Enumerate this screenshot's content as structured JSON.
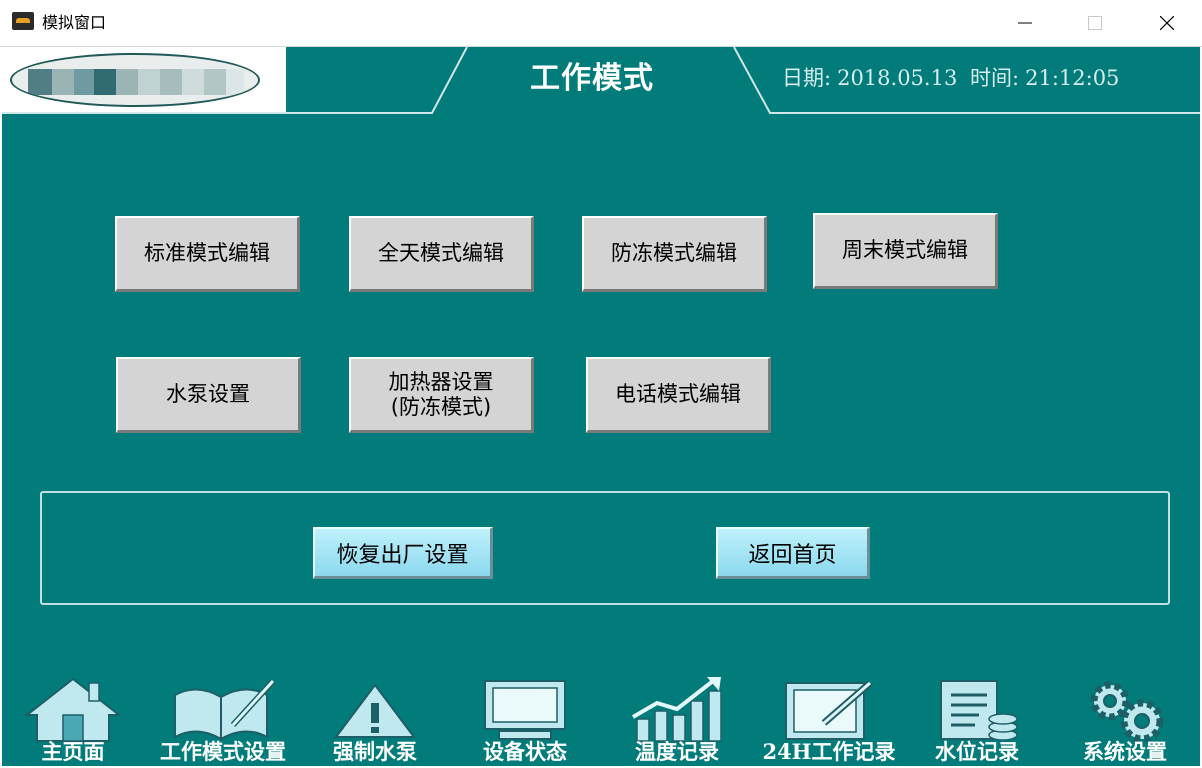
{
  "window": {
    "title": "模拟窗口"
  },
  "header": {
    "title": "工作模式",
    "date_label": "日期:",
    "date": "2018.05.13",
    "time_label": "时间:",
    "time": "21:12:05"
  },
  "modes": [
    {
      "label": "标准模式编辑"
    },
    {
      "label": "全天模式编辑"
    },
    {
      "label": "防冻模式编辑"
    },
    {
      "label": "周末模式编辑"
    },
    {
      "label": "水泵设置"
    },
    {
      "label_line1": "加热器设置",
      "label_line2": "(防冻模式)"
    },
    {
      "label": "电话模式编辑"
    }
  ],
  "actions": {
    "factory_reset": "恢复出厂设置",
    "back_home": "返回首页"
  },
  "nav": [
    {
      "label": "主页面",
      "icon": "house-icon"
    },
    {
      "label": "工作模式设置",
      "icon": "book-pen-icon"
    },
    {
      "label": "强制水泵",
      "icon": "warning-icon"
    },
    {
      "label": "设备状态",
      "icon": "monitor-icon"
    },
    {
      "label": "温度记录",
      "icon": "rising-chart-icon"
    },
    {
      "label": "24H工作记录",
      "icon": "tablet-pen-icon"
    },
    {
      "label": "水位记录",
      "icon": "document-coins-icon"
    },
    {
      "label": "系统设置",
      "icon": "gears-icon"
    }
  ],
  "colors": {
    "background": "#017c7a",
    "mode_button": "#d4d4d4",
    "action_button": "#a9e6f5"
  }
}
